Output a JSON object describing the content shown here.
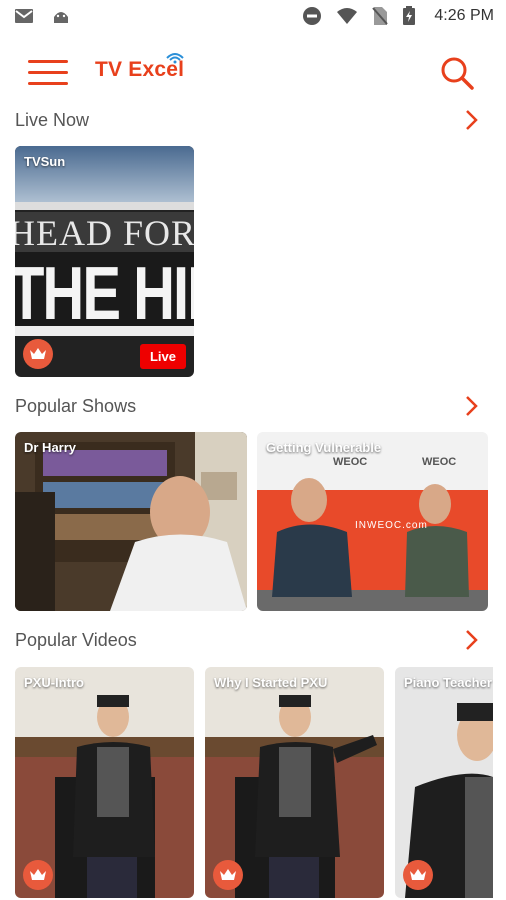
{
  "status_bar": {
    "time": "4:26 PM"
  },
  "app": {
    "logo_text_a": "TV E",
    "logo_text_b": "xcel"
  },
  "sections": {
    "live_now": {
      "title": "Live Now"
    },
    "popular_shows": {
      "title": "Popular Shows"
    },
    "popular_videos": {
      "title": "Popular Videos"
    }
  },
  "live": {
    "channel": "TVSun",
    "poster_line1": "HEAD FOR",
    "poster_line2": "THE HILLS",
    "badge": "Live"
  },
  "shows": [
    {
      "label": "Dr Harry"
    },
    {
      "label": "Getting Vulnerable",
      "brand": "WEOC",
      "banner": "INWEOC.com"
    }
  ],
  "videos": [
    {
      "label": "PXU-Intro"
    },
    {
      "label": "Why I Started PXU"
    },
    {
      "label": "Piano Teacher"
    }
  ],
  "colors": {
    "accent": "#e8401c",
    "live_red": "#e00000",
    "crown_bg": "#e85a3c"
  },
  "icons": [
    "gmail-icon",
    "android-icon",
    "do-not-disturb-icon",
    "wifi-icon",
    "no-sim-icon",
    "battery-icon",
    "menu-icon",
    "search-icon",
    "chevron-right-icon",
    "crown-icon"
  ]
}
